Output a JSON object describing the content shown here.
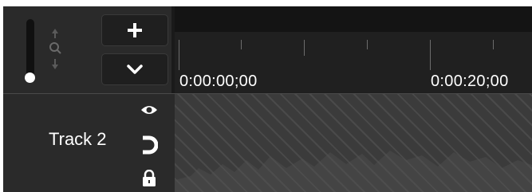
{
  "toolbar": {
    "add_track_icon": "plus-icon",
    "collapse_icon": "chevron-down-icon",
    "zoom_icon": "magnifier-icon"
  },
  "ruler": {
    "labels": [
      "0:00:00;00",
      "0:00:20;00"
    ]
  },
  "tracks": [
    {
      "name": "Track 2",
      "icons": [
        "eye-icon",
        "magnet-icon",
        "lock-icon"
      ]
    }
  ],
  "colors": {
    "background": "#1d1d1d",
    "panel": "#2a2a2a",
    "text": "#ffffff",
    "track_area": "#3b3b3b"
  }
}
